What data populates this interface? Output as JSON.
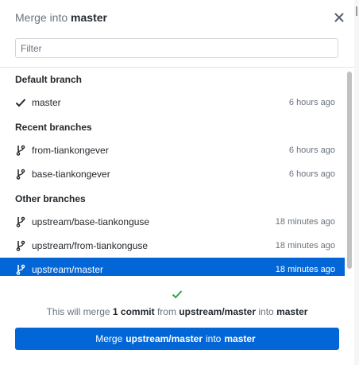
{
  "dialog": {
    "title_prefix": "Merge into",
    "title_branch": "master",
    "close_icon": "close-icon"
  },
  "filter": {
    "placeholder": "Filter",
    "value": ""
  },
  "groups": {
    "default": {
      "label": "Default branch",
      "items": [
        {
          "name": "master",
          "time": "6 hours ago",
          "icon": "check-icon"
        }
      ]
    },
    "recent": {
      "label": "Recent branches",
      "items": [
        {
          "name": "from-tiankongever",
          "time": "6 hours ago",
          "icon": "branch-icon"
        },
        {
          "name": "base-tiankongever",
          "time": "6 hours ago",
          "icon": "branch-icon"
        }
      ]
    },
    "other": {
      "label": "Other branches",
      "items": [
        {
          "name": "upstream/base-tiankonguse",
          "time": "18 minutes ago",
          "icon": "branch-icon"
        },
        {
          "name": "upstream/from-tiankonguse",
          "time": "18 minutes ago",
          "icon": "branch-icon"
        },
        {
          "name": "upstream/master",
          "time": "18 minutes ago",
          "icon": "branch-icon",
          "selected": true
        }
      ]
    }
  },
  "footer": {
    "status_icon": "check-icon",
    "summary_prefix": "This will merge",
    "summary_count": "1 commit",
    "summary_from": "from",
    "summary_source": "upstream/master",
    "summary_into": "into",
    "summary_target": "master",
    "button_prefix": "Merge",
    "button_source": "upstream/master",
    "button_into": "into",
    "button_target": "master"
  },
  "colors": {
    "accent": "#0366d6",
    "success": "#28a745",
    "muted_text": "#6a737d",
    "text": "#24292e"
  }
}
